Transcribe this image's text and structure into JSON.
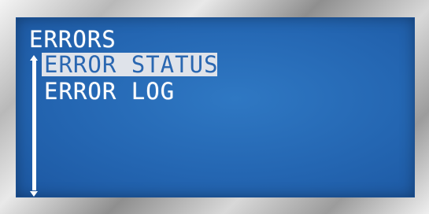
{
  "screen": {
    "title": "ERRORS",
    "menu": {
      "items": [
        {
          "label": "ERROR STATUS",
          "selected": true
        },
        {
          "label": "ERROR LOG",
          "selected": false
        }
      ]
    }
  },
  "icons": {
    "scroll_up": "scroll-up-arrow-icon",
    "scroll_down": "scroll-down-arrow-icon"
  },
  "colors": {
    "screen_background": "#2466b2",
    "text": "#ffffff",
    "selection_background": "#dfe3ea",
    "selection_text": "#2a67b1"
  }
}
